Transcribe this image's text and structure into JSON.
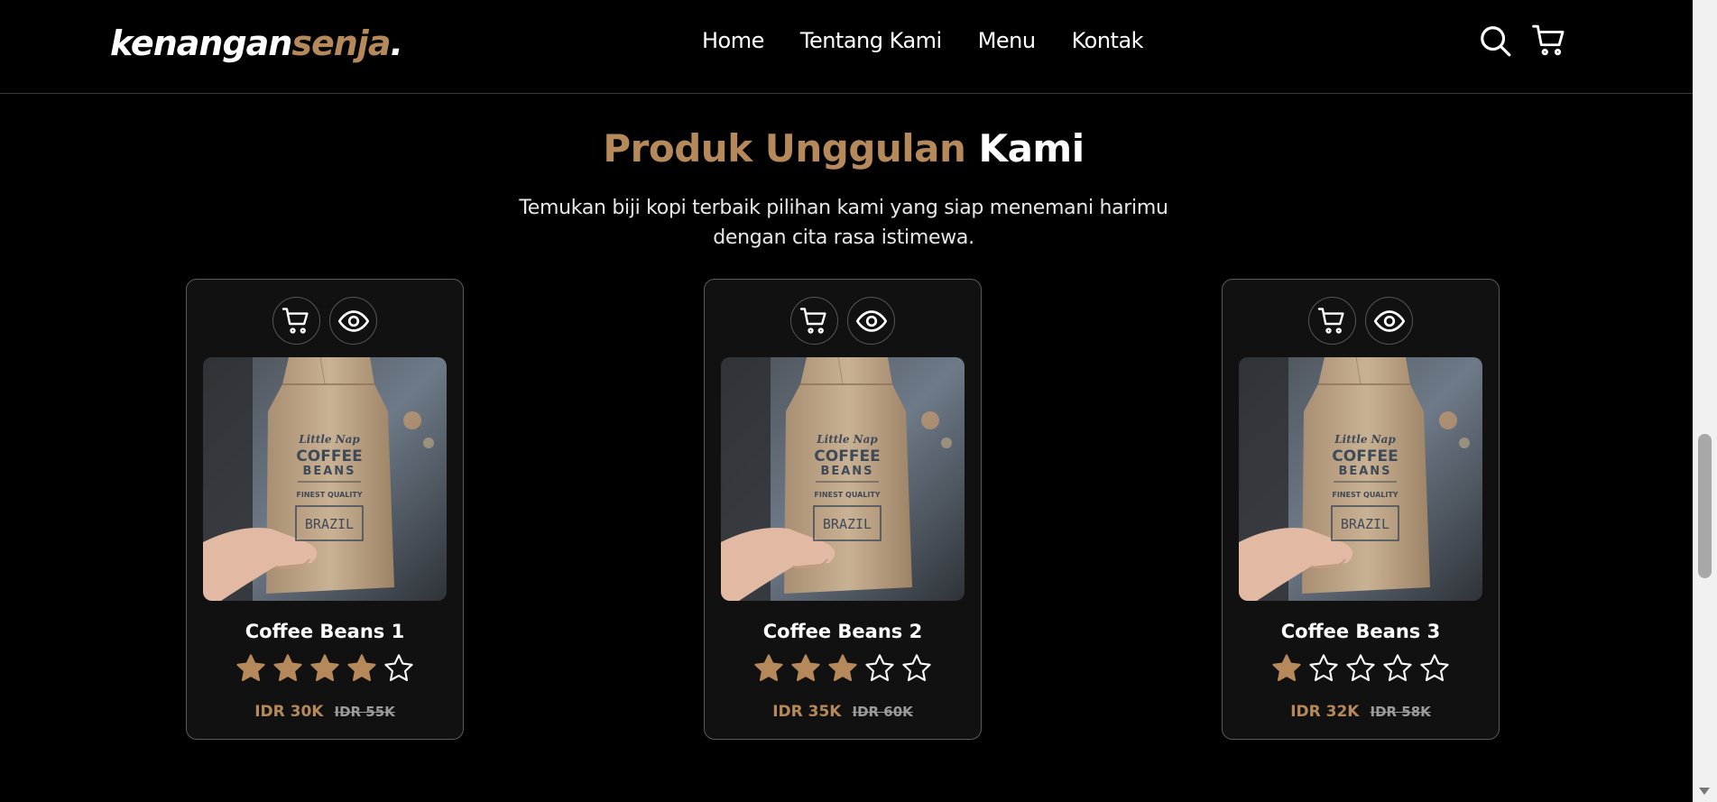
{
  "brand": {
    "name_main": "kenangan",
    "name_accent": "senja",
    "name_dot": "."
  },
  "nav": {
    "items": [
      "Home",
      "Tentang Kami",
      "Menu",
      "Kontak"
    ]
  },
  "colors": {
    "accent": "#b6895b",
    "background": "#000000",
    "card": "#111111"
  },
  "icons": {
    "search": "search-icon",
    "cart": "cart-icon",
    "view": "eye-icon",
    "star": "star-icon"
  },
  "section": {
    "title_accent": "Produk Unggulan",
    "title_rest": "Kami",
    "subtitle": "Temukan biji kopi terbaik pilihan kami yang siap menemani harimu dengan cita rasa istimewa."
  },
  "products": [
    {
      "name": "Coffee Beans 1",
      "rating": 4,
      "max_rating": 5,
      "price": "IDR 30K",
      "old_price": "IDR 55K"
    },
    {
      "name": "Coffee Beans 2",
      "rating": 3,
      "max_rating": 5,
      "price": "IDR 35K",
      "old_price": "IDR 60K"
    },
    {
      "name": "Coffee Beans 3",
      "rating": 1,
      "max_rating": 5,
      "price": "IDR 32K",
      "old_price": "IDR 58K"
    }
  ],
  "bag_label": {
    "brand": "Little Nap",
    "line1": "COFFEE",
    "line2": "BEANS",
    "quality": "FINEST QUALITY",
    "origin": "BRAZIL"
  }
}
